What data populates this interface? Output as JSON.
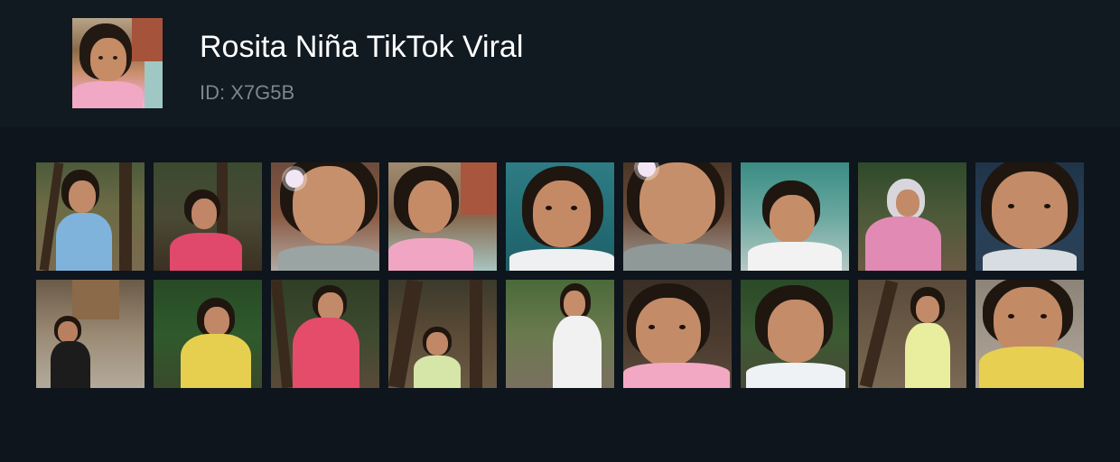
{
  "header": {
    "title": "Rosita Niña TikTok Viral",
    "id_text": "ID: X7G5B"
  },
  "colors": {
    "background": "#0e151d",
    "header_background": "#111921",
    "title": "#ffffff",
    "subtitle": "#7c8590"
  },
  "grid": {
    "rows": [
      [
        {
          "name": "thumb-1",
          "scene": "girl-blue-dress-outdoor"
        },
        {
          "name": "thumb-2",
          "scene": "girl-pink-floral-outdoor"
        },
        {
          "name": "thumb-3",
          "scene": "girl-closeup-flower"
        },
        {
          "name": "thumb-4",
          "scene": "girl-pink-shirt-indoor"
        },
        {
          "name": "thumb-5",
          "scene": "girl-closeup-frown"
        },
        {
          "name": "thumb-6",
          "scene": "girl-closeup-flower-tilt"
        },
        {
          "name": "thumb-7",
          "scene": "girl-hands-on-head"
        },
        {
          "name": "thumb-8",
          "scene": "girl-pink-hoodie-outdoor"
        },
        {
          "name": "thumb-9",
          "scene": "girl-closeup-frown-dark"
        }
      ],
      [
        {
          "name": "thumb-10",
          "scene": "girl-black-shirt-wall"
        },
        {
          "name": "thumb-11",
          "scene": "girl-yellow-dress-plants"
        },
        {
          "name": "thumb-12",
          "scene": "girl-pink-floral-tree"
        },
        {
          "name": "thumb-13",
          "scene": "girl-green-dress-wood"
        },
        {
          "name": "thumb-14",
          "scene": "girl-white-dress-yard"
        },
        {
          "name": "thumb-15",
          "scene": "girl-closeup-pink-collar"
        },
        {
          "name": "thumb-16",
          "scene": "girl-closeup-outdoor"
        },
        {
          "name": "thumb-17",
          "scene": "girl-yellow-dress-wood"
        },
        {
          "name": "thumb-18",
          "scene": "girl-closeup-yellow-dress"
        }
      ]
    ]
  }
}
